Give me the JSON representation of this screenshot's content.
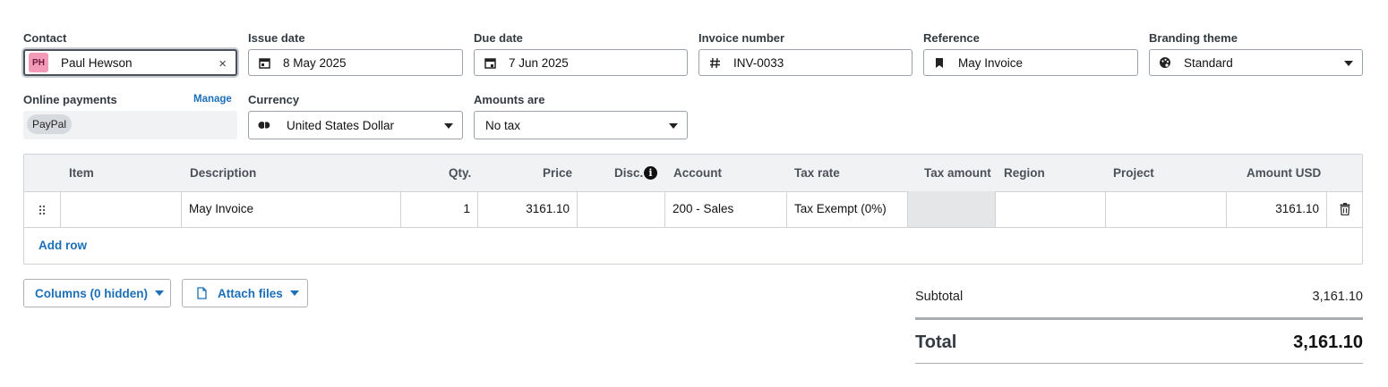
{
  "fields": {
    "contact": {
      "label": "Contact",
      "initials": "PH",
      "value": "Paul Hewson",
      "clear_icon": "×"
    },
    "issue_date": {
      "label": "Issue date",
      "value": "8 May 2025"
    },
    "due_date": {
      "label": "Due date",
      "value": "7 Jun 2025"
    },
    "invoice_number": {
      "label": "Invoice number",
      "value": "INV-0033"
    },
    "reference": {
      "label": "Reference",
      "value": "May Invoice"
    },
    "branding_theme": {
      "label": "Branding theme",
      "value": "Standard"
    },
    "online_payments": {
      "label": "Online payments",
      "manage_label": "Manage",
      "methods": [
        "PayPal"
      ]
    },
    "currency": {
      "label": "Currency",
      "value": "United States Dollar"
    },
    "amounts_are": {
      "label": "Amounts are",
      "value": "No tax"
    }
  },
  "icons": {
    "issue_date": "calendar-icon",
    "due_date": "calendar-icon",
    "invoice_number": "hash-icon",
    "reference": "bookmark-icon",
    "branding_theme": "palette-icon",
    "currency": "currency-icon",
    "drag_handle": "drag-handle-icon",
    "delete_row": "trash-icon",
    "disc_info": "info-icon",
    "attach": "document-icon"
  },
  "table": {
    "headers": [
      "Item",
      "Description",
      "Qty.",
      "Price",
      "Disc.",
      "Account",
      "Tax rate",
      "Tax amount",
      "Region",
      "Project",
      "Amount USD"
    ],
    "rows": [
      {
        "item": "",
        "description": "May Invoice",
        "qty": "1",
        "price": "3161.10",
        "disc": "",
        "account": "200 - Sales",
        "tax_rate": "Tax Exempt (0%)",
        "tax_amount": "",
        "region": "",
        "project": "",
        "amount": "3161.10"
      }
    ],
    "add_row_label": "Add row"
  },
  "actions": {
    "columns_label": "Columns (0 hidden)",
    "attach_label": "Attach files"
  },
  "totals": {
    "subtotal_label": "Subtotal",
    "subtotal_value": "3,161.10",
    "total_label": "Total",
    "total_value": "3,161.10"
  },
  "colors": {
    "accent": "#1c6fb8",
    "avatar_bg": "#f39ab8",
    "header_bg": "#f1f2f4"
  }
}
